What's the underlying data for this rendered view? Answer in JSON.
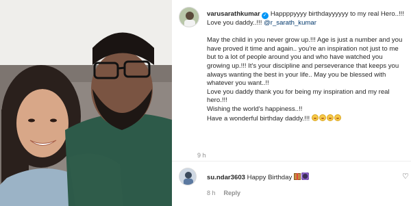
{
  "post": {
    "username": "varusarathkumar",
    "caption_first": "Happppyyyy birthdayyyyyy to my real Hero..!!!",
    "love_line": "Love you daddy..!!! ",
    "mention": "@r_sarath_kumar",
    "paragraph": "May the child in you never grow up.!!! Age is just a number and you have proved it time and again.. you're an inspiration not just to me but to a lot of people around you and who have watched you growing up.!!! It's your discipline and perseverance that keeps you always wanting the best in your life.. May you be blessed with whatever you want..!!",
    "line_love": "Love you daddy thank you for being my inspiration and my real hero.!!!",
    "line_wishing": "Wishing the world's happiness..!!",
    "line_birthday": "Have a wonderful birthday daddy.!!! ",
    "emoji_count": 4,
    "time": "9 h"
  },
  "comment": {
    "username": "su.ndar3603",
    "text": "Happy Birthday ",
    "time": "8 h",
    "reply_label": "Reply",
    "icons": [
      "gift-emoji",
      "star-emoji",
      "heart-icon"
    ]
  },
  "colors": {
    "verified": "#0095f6",
    "mention": "#00376b",
    "meta": "#8e8e8e"
  }
}
